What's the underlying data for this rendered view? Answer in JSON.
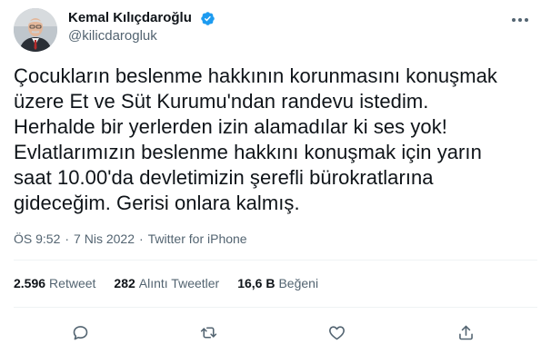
{
  "author": {
    "display_name": "Kemal Kılıçdaroğlu",
    "handle": "@kilicdarogluk",
    "verified_icon": "verified-badge-icon",
    "verified_color": "#1d9bf0"
  },
  "tweet": {
    "lines": [
      "Çocukların beslenme hakkının korunmasını konuşmak",
      "üzere Et ve Süt Kurumu'ndan randevu istedim.",
      "Herhalde bir yerlerden izin alamadılar ki ses yok!",
      "Evlatlarımızın beslenme hakkını konuşmak için yarın",
      "saat 10.00'da devletimizin şerefli bürokratlarına",
      "gideceğim. Gerisi onlara kalmış."
    ]
  },
  "meta": {
    "time": "ÖS 9:52",
    "date": "7 Nis 2022",
    "source": "Twitter for iPhone",
    "separator": "·"
  },
  "stats": {
    "retweets": {
      "count": "2.596",
      "label": "Retweet"
    },
    "quotes": {
      "count": "282",
      "label": "Alıntı Tweetler"
    },
    "likes": {
      "count": "16,6 B",
      "label": "Beğeni"
    }
  },
  "actions": [
    "reply-icon",
    "retweet-icon",
    "like-icon",
    "share-icon"
  ],
  "colors": {
    "text": "#0f1419",
    "secondary": "#536471",
    "divider": "#eff3f4"
  }
}
